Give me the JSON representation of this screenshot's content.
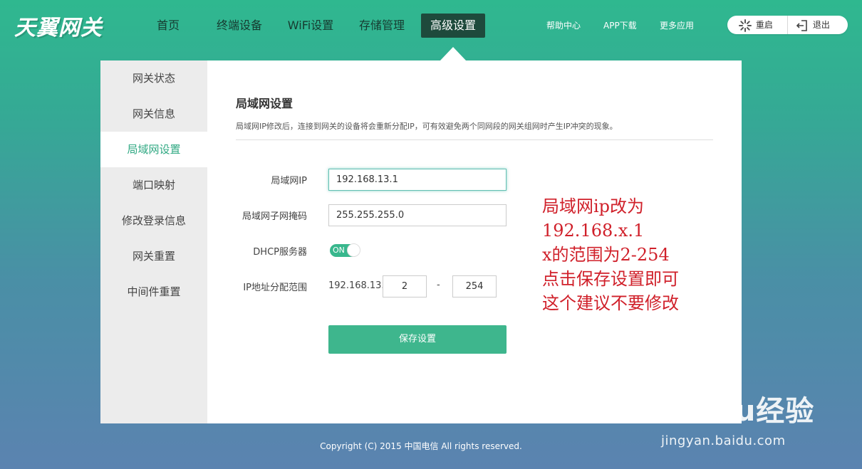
{
  "brand": {
    "logo": "天翼网关"
  },
  "nav": {
    "items": [
      "首页",
      "终端设备",
      "WiFi设置",
      "存储管理",
      "高级设置"
    ],
    "active": "高级设置"
  },
  "links": [
    "帮助中心",
    "APP下载",
    "更多应用"
  ],
  "controls": {
    "restart": "重启",
    "logout": "退出"
  },
  "sidebar": {
    "items": [
      "网关状态",
      "网关信息",
      "局域网设置",
      "端口映射",
      "修改登录信息",
      "网关重置",
      "中间件重置"
    ],
    "active": "局域网设置"
  },
  "main": {
    "title": "局域网设置",
    "description": "局域网IP修改后，连接到网关的设备将会重新分配IP，可有效避免两个同网段的网关组网时产生IP冲突的现象。",
    "fields": {
      "lan_ip": {
        "label": "局域网IP",
        "value": "192.168.13.1"
      },
      "subnet": {
        "label": "局域网子网掩码",
        "value": "255.255.255.0"
      },
      "dhcp": {
        "label": "DHCP服务器",
        "state": "ON"
      },
      "range": {
        "label": "IP地址分配范围",
        "prefix": "192.168.13.",
        "start": "2",
        "dash": "-",
        "end": "254"
      }
    },
    "save_label": "保存设置"
  },
  "annotation": [
    "局域网ip改为",
    "192.168.x.1",
    "x的范围为2-254",
    "点击保存设置即可",
    "这个建议不要修改"
  ],
  "footer": "Copyright (C) 2015 中国电信 All rights reserved.",
  "watermark": {
    "brand": "Baidu经验",
    "url": "jingyan.baidu.com"
  },
  "colors": {
    "accent": "#3eb68d",
    "nav_active": "#1e4a3c",
    "annotation": "#d0202a"
  }
}
